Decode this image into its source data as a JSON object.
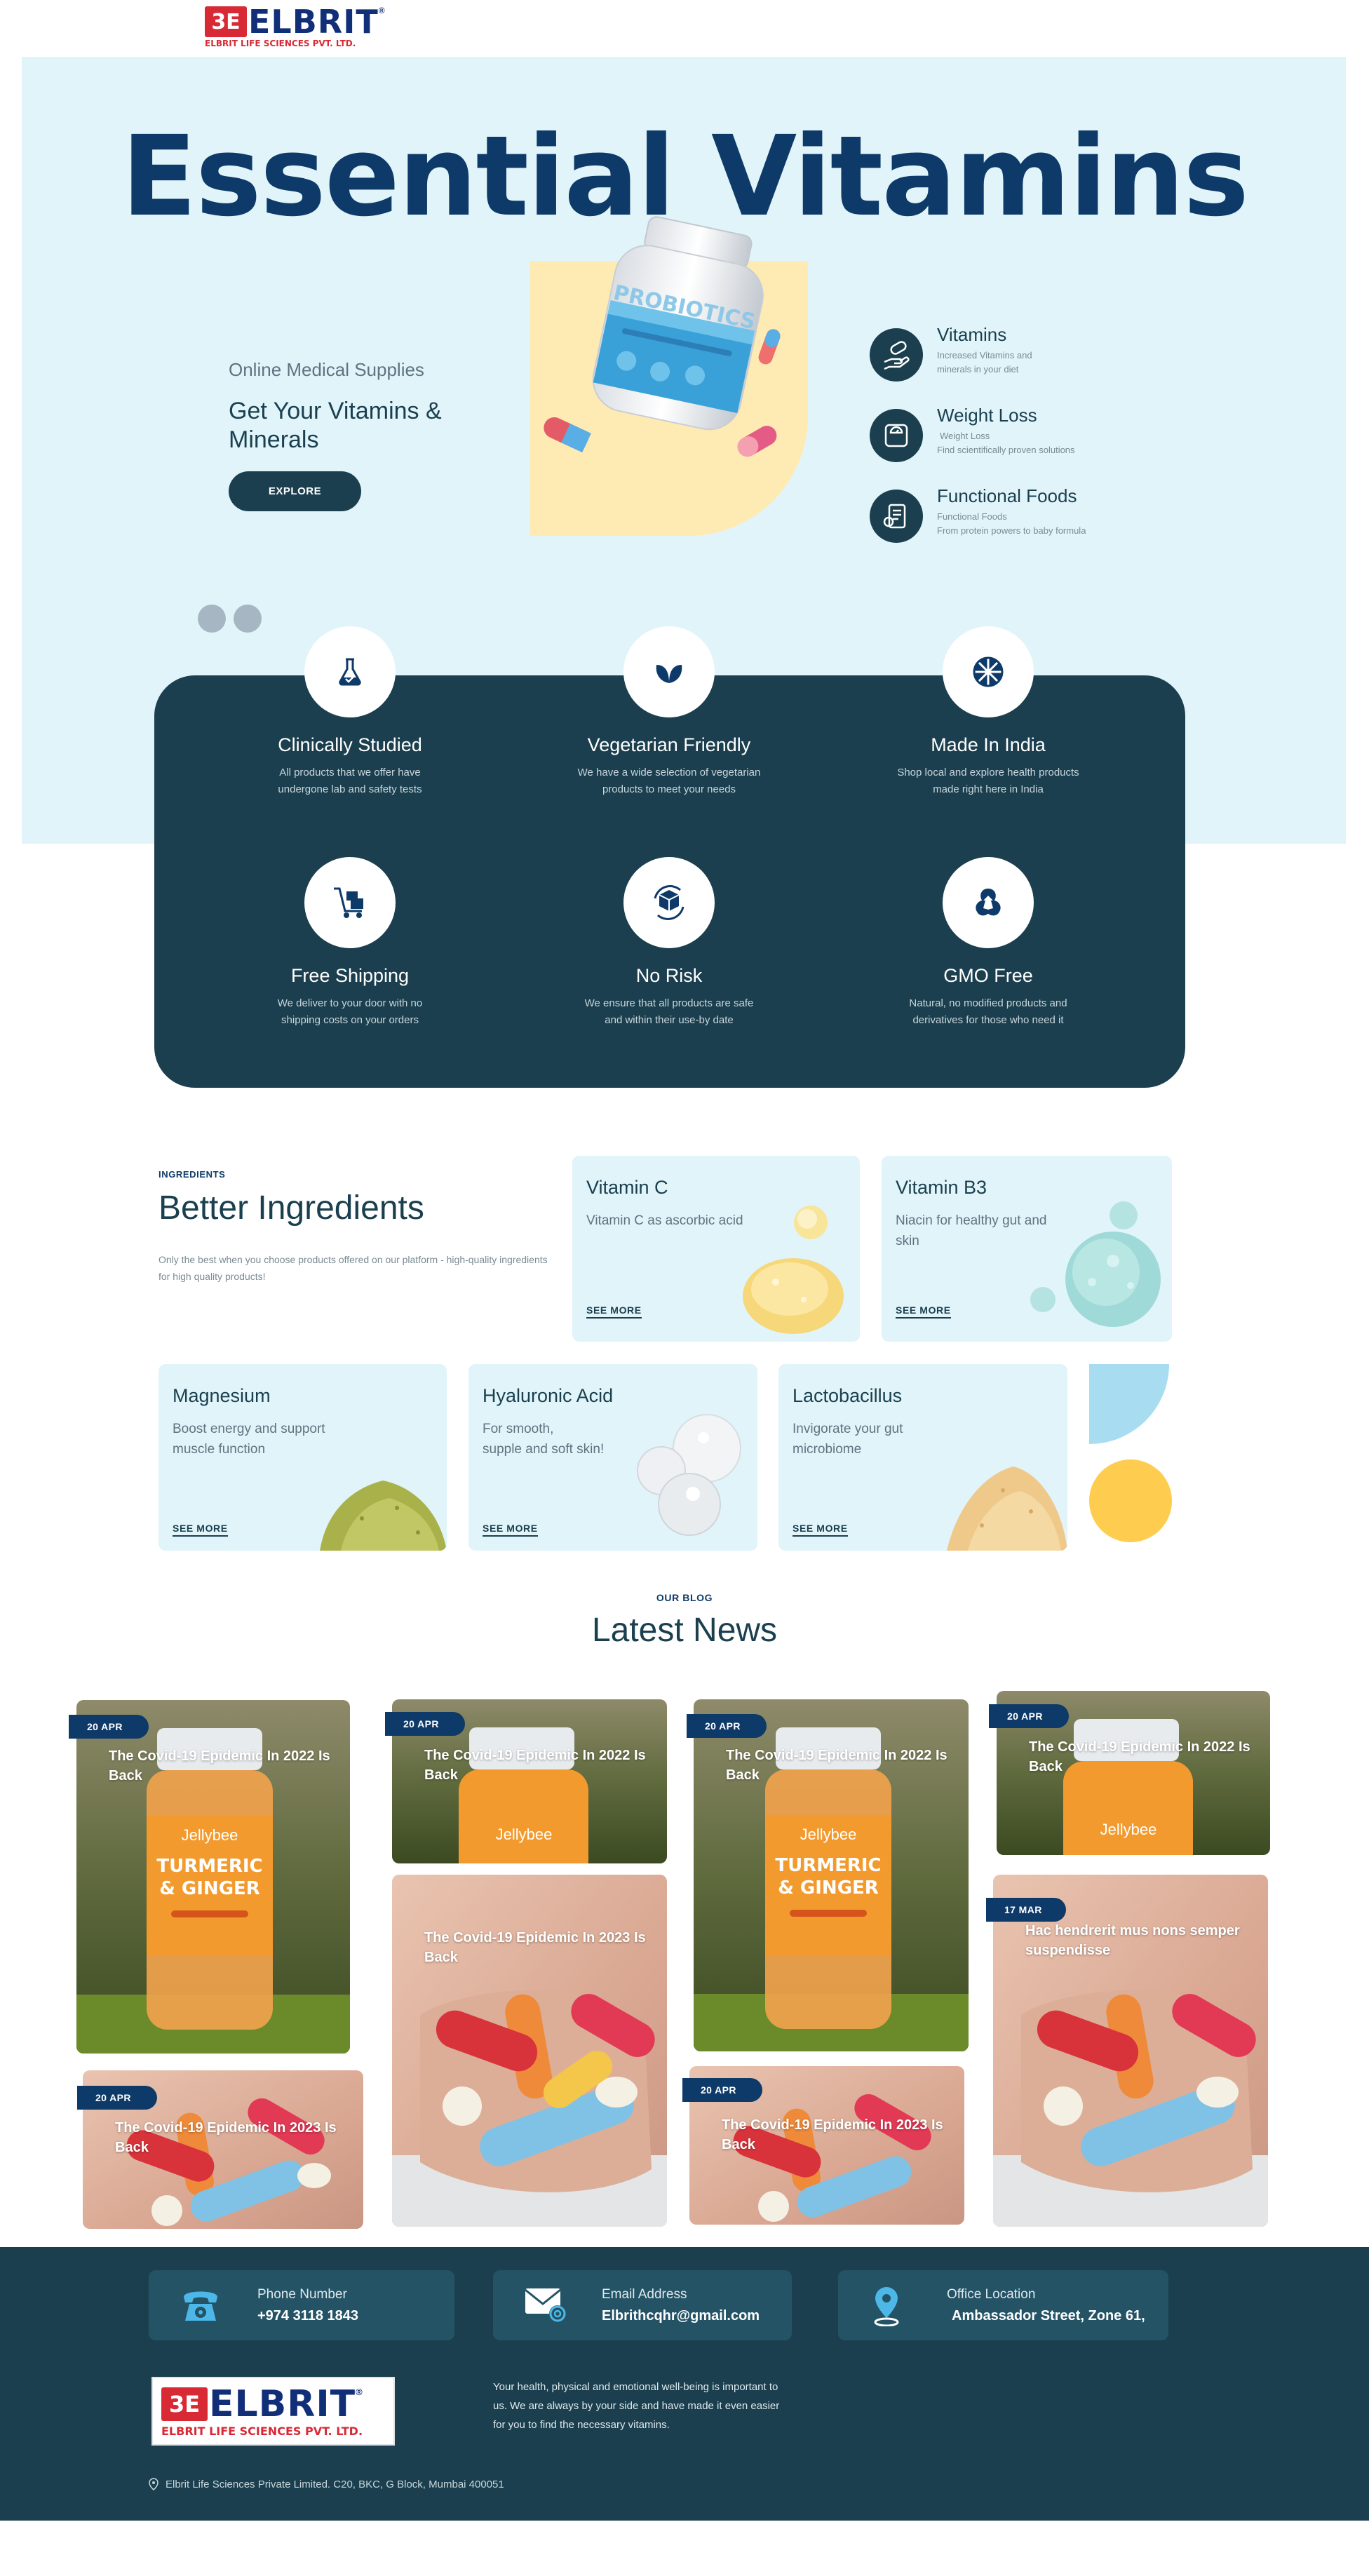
{
  "brand": {
    "mark": "3E",
    "name": "ELBRIT",
    "reg": "®",
    "tagline": "ELBRIT LIFE SCIENCES PVT. LTD."
  },
  "hero": {
    "title": "Essential Vitamins",
    "subtitle": "Online Medical Supplies",
    "heading": "Get Your Vitamins & Minerals",
    "cta": "EXPLORE",
    "product_label": "PROBIOTICS",
    "categories": [
      {
        "title": "Vitamins",
        "line1": "Increased Vitamins and",
        "line2": "minerals in your diet",
        "icon": "pill-hand-icon"
      },
      {
        "title": "Weight Loss",
        "line1": "Weight Loss",
        "line2": "Find scientifically proven solutions",
        "icon": "scale-icon"
      },
      {
        "title": "Functional Foods",
        "line1": "Functional Foods",
        "line2": "From protein powers to baby formula",
        "icon": "food-icon"
      }
    ]
  },
  "features": [
    {
      "title": "Clinically Studied",
      "line1": "All products that we offer have",
      "line2": "undergone lab and safety tests",
      "icon": "flask-icon"
    },
    {
      "title": "Vegetarian Friendly",
      "line1": "We have a wide selection of vegetarian",
      "line2": "products to meet your needs",
      "icon": "leaf-icon"
    },
    {
      "title": "Made In India",
      "line1": "Shop local and explore health products",
      "line2": "made right here in India",
      "icon": "globe-icon"
    },
    {
      "title": "Free Shipping",
      "line1": "We deliver to your door with no",
      "line2": "shipping costs on your orders",
      "icon": "cart-icon"
    },
    {
      "title": "No Risk",
      "line1": "We ensure that all products are safe",
      "line2": "and within their use-by date",
      "icon": "box-icon"
    },
    {
      "title": "GMO Free",
      "line1": "Natural, no modified products and",
      "line2": "derivatives for those who need it",
      "icon": "gmo-icon"
    }
  ],
  "ingredients": {
    "label": "INGREDIENTS",
    "heading": "Better Ingredients",
    "description": "Only the best when you choose products offered on our platform - high-quality ingredients for high quality products!",
    "see_more": "SEE MORE",
    "cards": [
      {
        "title": "Vitamin C",
        "line1": "Vitamin C as ascorbic acid",
        "line2": ""
      },
      {
        "title": "Vitamin B3",
        "line1": "Niacin for healthy gut and skin",
        "line2": ""
      },
      {
        "title": "Magnesium",
        "line1": "Boost energy and support",
        "line2": "muscle function"
      },
      {
        "title": "Hyaluronic Acid",
        "line1": "For smooth,",
        "line2": "supple and soft skin!"
      },
      {
        "title": "Lactobacillus",
        "line1": "Invigorate your gut",
        "line2": "microbiome"
      }
    ]
  },
  "blog": {
    "label": "OUR BLOG",
    "heading": "Latest News",
    "bottle_brand": "Jellybee",
    "bottle_line1": "TURMERIC",
    "bottle_line2": "& GINGER",
    "posts": [
      {
        "date": "20 APR",
        "title": "The Covid-19 Epidemic In 2022 Is Back"
      },
      {
        "date": "20 APR",
        "title": "The Covid-19 Epidemic In 2023 Is Back"
      },
      {
        "date": "20 APR",
        "title": "The Covid-19 Epidemic In 2022 Is Back"
      },
      {
        "date": "",
        "title": "The Covid-19 Epidemic In 2023 Is Back"
      },
      {
        "date": "20 APR",
        "title": "The Covid-19 Epidemic In 2022 Is Back"
      },
      {
        "date": "20 APR",
        "title": "The Covid-19 Epidemic In 2023 Is Back"
      },
      {
        "date": "20 APR",
        "title": "The Covid-19 Epidemic In 2022 Is Back"
      },
      {
        "date": "17 MAR",
        "title": "Hac hendrerit mus nons semper suspendisse"
      }
    ]
  },
  "footer": {
    "contacts": [
      {
        "label": "Phone Number",
        "value": "+974 3118 1843",
        "icon": "phone-icon"
      },
      {
        "label": "Email Address",
        "value": "Elbrithcqhr@gmail.com",
        "icon": "mail-icon"
      },
      {
        "label": "Office Location",
        "value": "Ambassador Street, Zone 61,",
        "icon": "location-icon"
      }
    ],
    "about": "Your health, physical and emotional well-being is important to us. We are always by your side and have made it even easier for you to find the necessary vitamins.",
    "address": "Elbrit Life Sciences Private Limited. C20, BKC, G Block, Mumbai 400051"
  },
  "colors": {
    "dark_teal": "#1b3f4e",
    "navy": "#0d3a68",
    "light_blue": "#e1f4fa",
    "yellow": "#feeab3",
    "brand_red": "#d82a35"
  }
}
